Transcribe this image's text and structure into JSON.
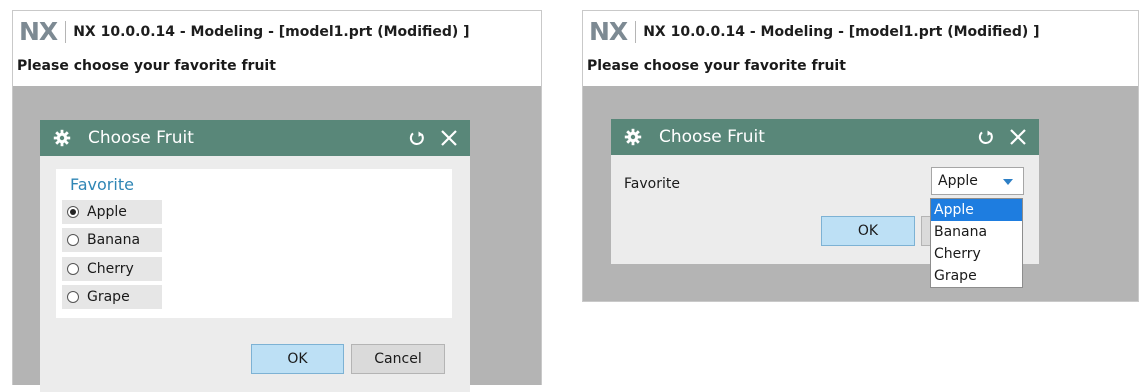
{
  "app": {
    "logo": "NX",
    "window_title": "NX 10.0.0.14 - Modeling - [model1.prt (Modified) ]",
    "prompt": "Please choose your favorite fruit"
  },
  "dialog": {
    "title": "Choose Fruit",
    "header_icons": [
      "gear-icon",
      "reset-icon",
      "close-icon"
    ],
    "header_color": "#598779",
    "group_label": "Favorite",
    "field_label": "Favorite",
    "options": [
      "Apple",
      "Banana",
      "Cherry",
      "Grape"
    ],
    "selected": "Apple",
    "ok_label": "OK",
    "cancel_label": "Cancel"
  },
  "colors": {
    "group_title": "#2f86b5",
    "dropdown_selection": "#1e7de0",
    "ok_button": "#bde0f5"
  }
}
